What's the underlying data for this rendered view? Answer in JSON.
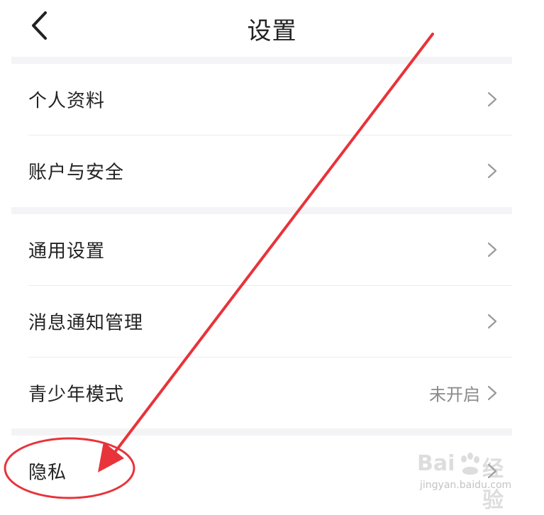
{
  "header": {
    "title": "设置",
    "back_icon": "chevron-left-icon"
  },
  "settings": {
    "group1": [
      {
        "label": "个人资料",
        "value": ""
      },
      {
        "label": "账户与安全",
        "value": ""
      }
    ],
    "group2": [
      {
        "label": "通用设置",
        "value": ""
      },
      {
        "label": "消息通知管理",
        "value": ""
      },
      {
        "label": "青少年模式",
        "value": "未开启"
      }
    ],
    "group3": [
      {
        "label": "隐私",
        "value": ""
      }
    ]
  },
  "watermark": {
    "brand": "Bai",
    "brand_tail": "经验",
    "url": "jingyan.baidu.com"
  },
  "colors": {
    "annotation": "#e8333a",
    "background": "#f4f4f6",
    "text": "#222222",
    "secondary_text": "#8a8a8a"
  }
}
